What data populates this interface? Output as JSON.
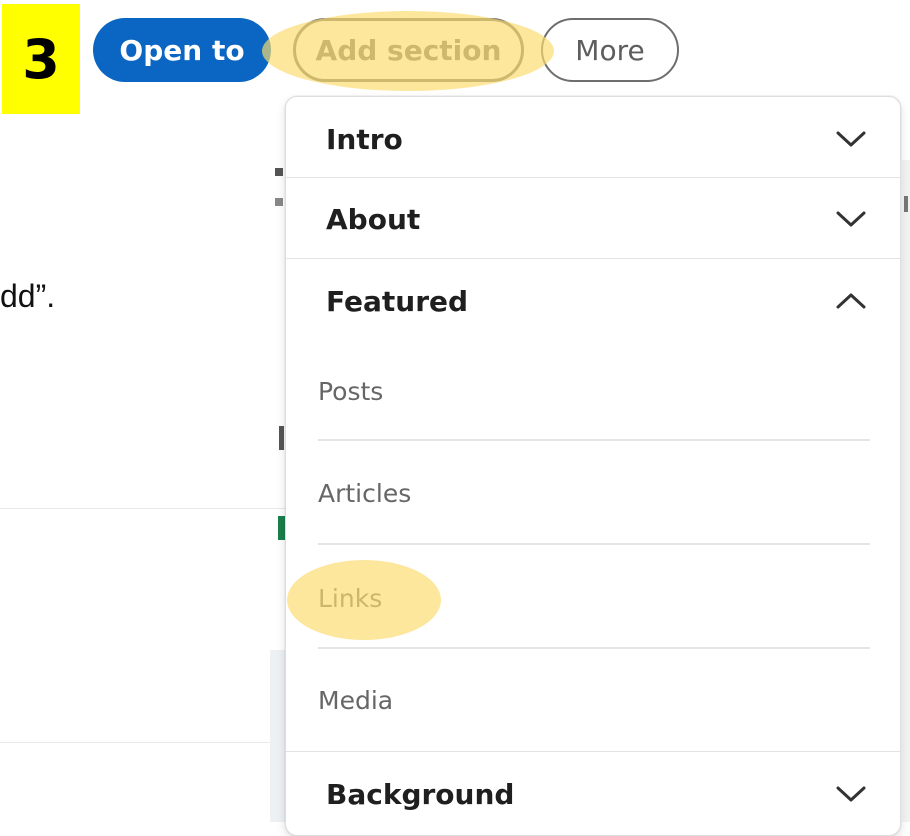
{
  "step": {
    "number": "3"
  },
  "toolbar": {
    "open_to_label": "Open to",
    "add_section_label": "Add section",
    "more_label": "More"
  },
  "background": {
    "instruction_fragment": "dd”."
  },
  "menu": {
    "sections": [
      {
        "label": "Intro",
        "expanded": false
      },
      {
        "label": "About",
        "expanded": false
      },
      {
        "label": "Featured",
        "expanded": true
      },
      {
        "label": "Background",
        "expanded": false
      }
    ],
    "featured_items": [
      "Posts",
      "Articles",
      "Links",
      "Media"
    ]
  },
  "colors": {
    "primary": "#0a66c2",
    "step_badge": "#ffff00",
    "highlight": "#fbdb6e",
    "menu_text": "#1f1f1f",
    "sub_text": "#666666"
  },
  "icons": {
    "collapsed": "chevron-down-icon",
    "expanded": "chevron-up-icon"
  }
}
